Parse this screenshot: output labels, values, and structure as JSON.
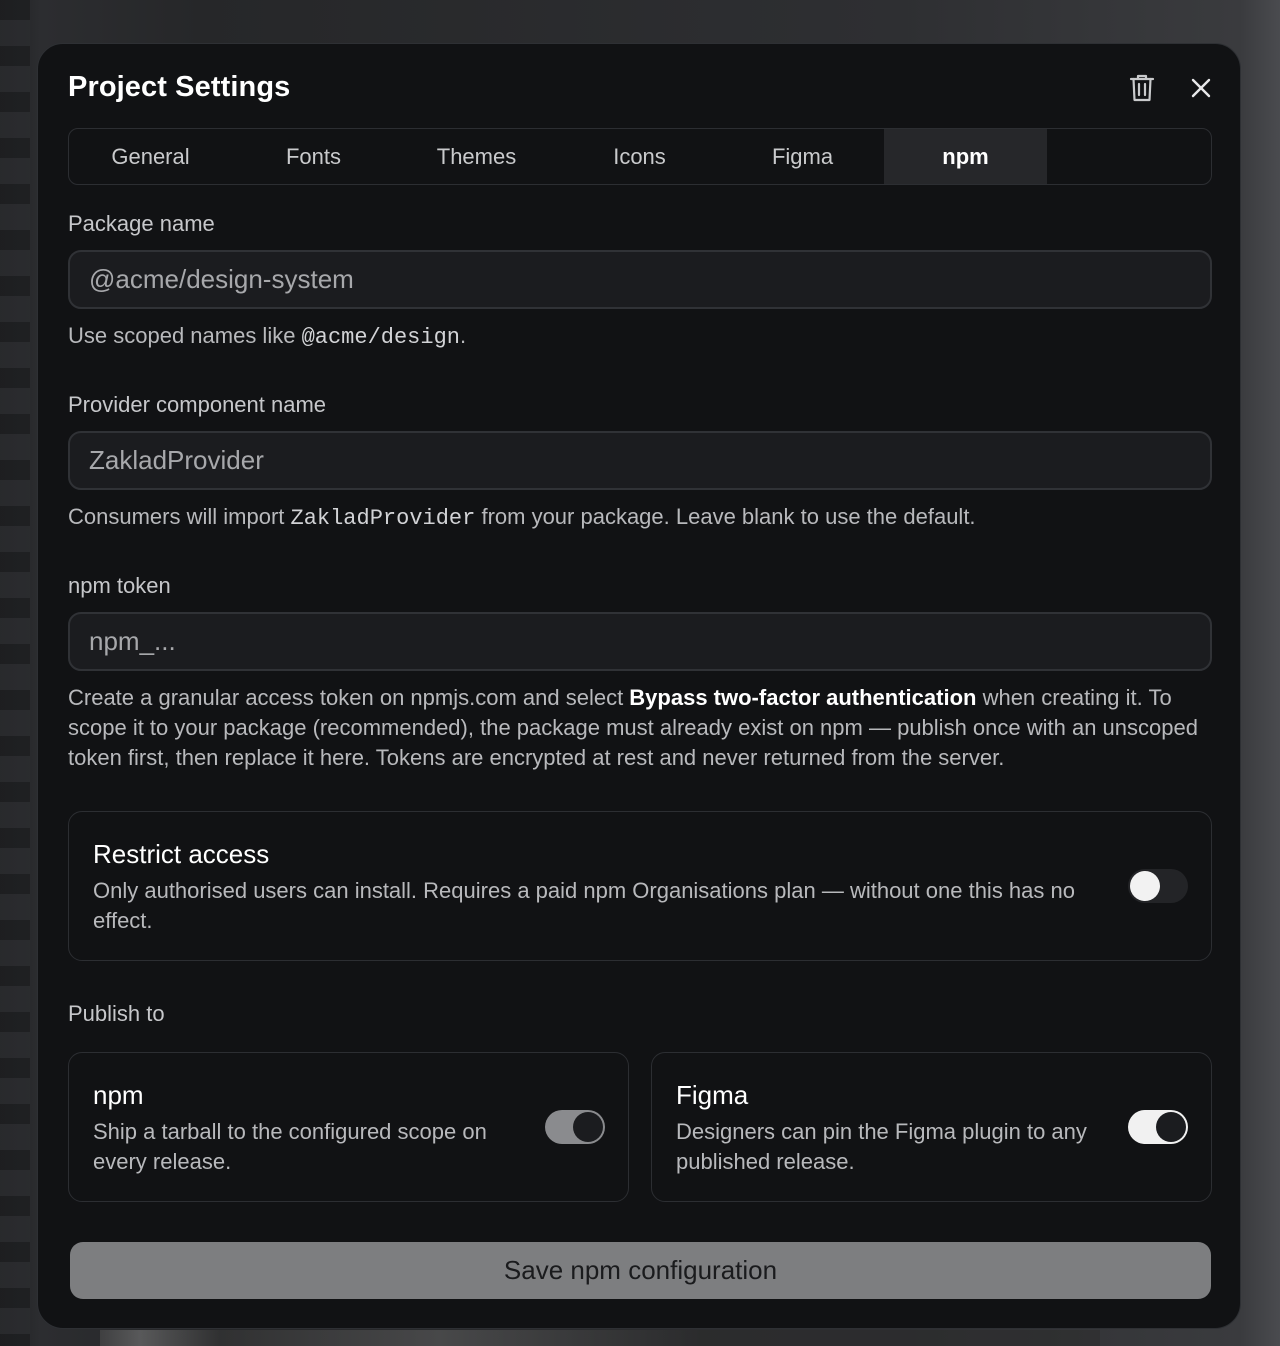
{
  "dialog": {
    "title": "Project Settings",
    "delete_icon": "trash-icon",
    "close_icon": "close-icon"
  },
  "tabs": [
    {
      "label": "General",
      "active": false
    },
    {
      "label": "Fonts",
      "active": false
    },
    {
      "label": "Themes",
      "active": false
    },
    {
      "label": "Icons",
      "active": false
    },
    {
      "label": "Figma",
      "active": false
    },
    {
      "label": "npm",
      "active": true
    }
  ],
  "package_name": {
    "label": "Package name",
    "placeholder": "@acme/design-system",
    "value": "",
    "help_prefix": "Use scoped names like ",
    "help_code": "@acme/design",
    "help_suffix": "."
  },
  "provider": {
    "label": "Provider component name",
    "placeholder": "ZakladProvider",
    "value": "",
    "help_prefix": "Consumers will import ",
    "help_code": "ZakladProvider",
    "help_suffix": " from your package. Leave blank to use the default."
  },
  "npm_token": {
    "label": "npm token",
    "placeholder": "npm_...",
    "value": "",
    "help_part1": "Create a granular access token on npmjs.com and select ",
    "help_bold": "Bypass two-factor authentication",
    "help_part2": " when creating it. To scope it to your package (recommended), the package must already exist on npm — publish once with an unscoped token first, then replace it here. Tokens are encrypted at rest and never returned from the server."
  },
  "restrict_access": {
    "title": "Restrict access",
    "description": "Only authorised users can install. Requires a paid npm Organisations plan — without one this has no effect.",
    "enabled": false
  },
  "publish_to": {
    "label": "Publish to",
    "targets": [
      {
        "title": "npm",
        "description": "Ship a tarball to the configured scope on every release.",
        "enabled": true
      },
      {
        "title": "Figma",
        "description": "Designers can pin the Figma plugin to any published release.",
        "enabled": true
      }
    ]
  },
  "save_button": {
    "label": "Save npm configuration"
  },
  "colors": {
    "modal_bg": "#111214",
    "accent_active_tab": "#26272a",
    "save_button_bg": "#7d7e80"
  }
}
